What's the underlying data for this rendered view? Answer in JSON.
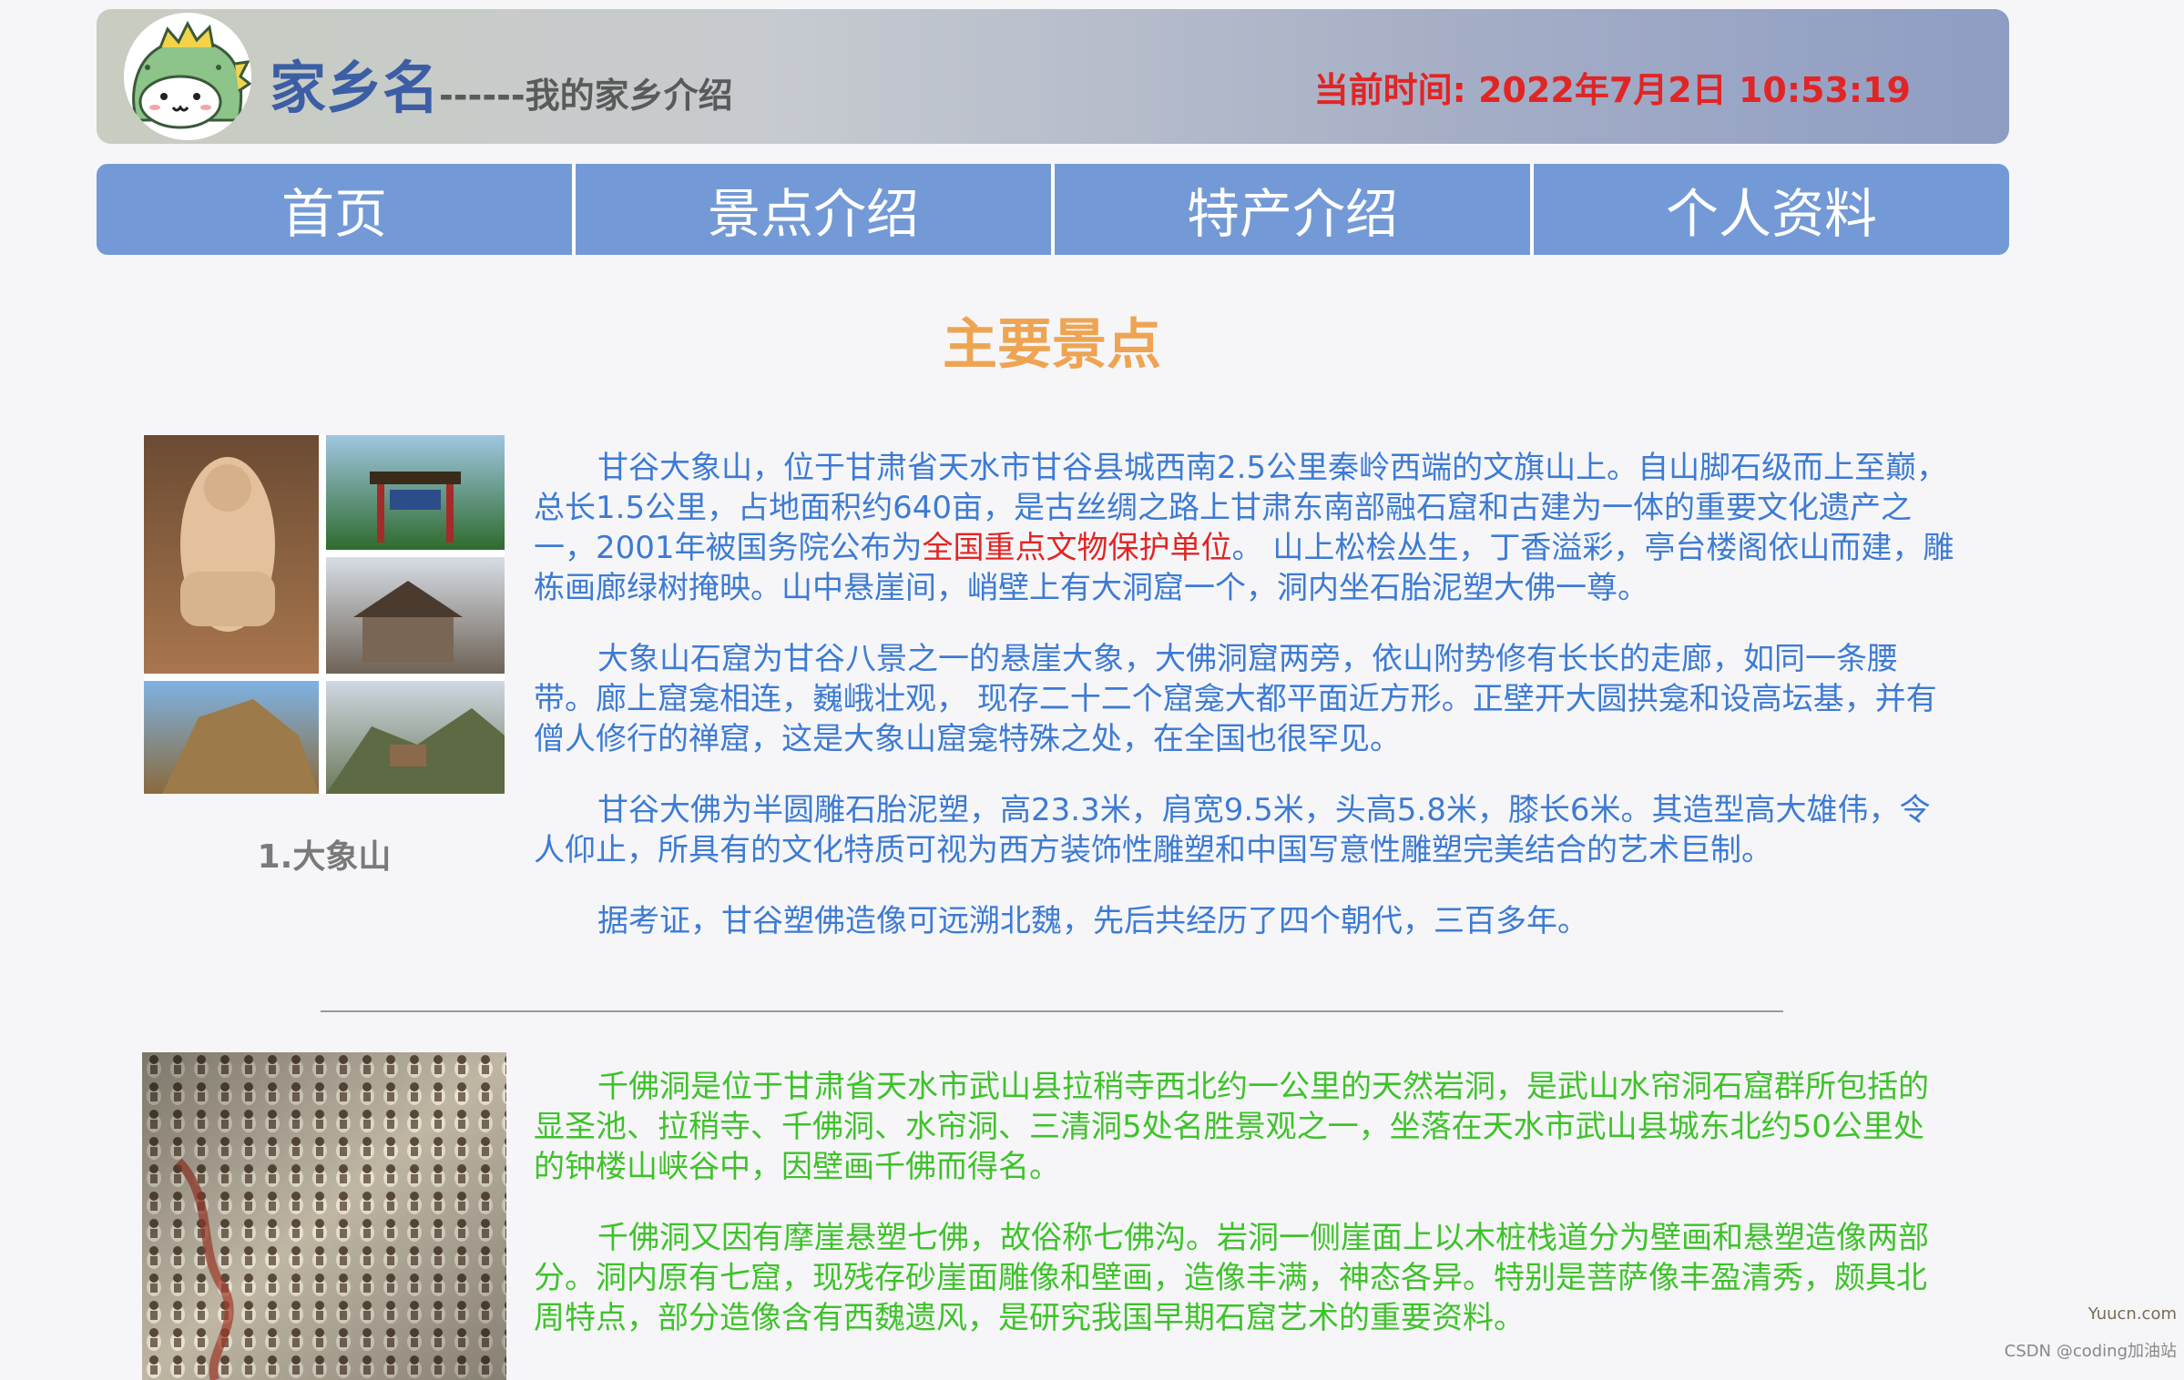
{
  "header": {
    "logo_icon": "dinosaur-mascot-icon",
    "site_name": "家乡名",
    "site_subtitle": "------我的家乡介绍",
    "clock_prefix": "当前时间: ",
    "clock_value": "2022年7月2日 10:53:19"
  },
  "nav": {
    "items": [
      {
        "label": "首页"
      },
      {
        "label": "景点介绍"
      },
      {
        "label": "特产介绍"
      },
      {
        "label": "个人资料"
      }
    ]
  },
  "main": {
    "section_title": "主要景点",
    "spot1": {
      "caption": "1.大象山",
      "p1_before": "甘谷大象山，位于甘肃省天水市甘谷县城西南2.5公里秦岭西端的文旗山上。自山脚石级而上至巅，总长1.5公里，占地面积约640亩，是古丝绸之路上甘肃东南部融石窟和古建为一体的重要文化遗产之一，2001年被国务院公布为",
      "p1_highlight": "全国重点文物保护单位",
      "p1_after": "。 山上松桧丛生，丁香溢彩，亭台楼阁依山而建，雕栋画廊绿树掩映。山中悬崖间，峭壁上有大洞窟一个，洞内坐石胎泥塑大佛一尊。",
      "p2": "大象山石窟为甘谷八景之一的悬崖大象，大佛洞窟两旁，依山附势修有长长的走廊，如同一条腰带。廊上窟龛相连，巍峨壮观， 现存二十二个窟龛大都平面近方形。正壁开大圆拱龛和设高坛基，并有僧人修行的禅窟，这是大象山窟龛特殊之处，在全国也很罕见。",
      "p3": "甘谷大佛为半圆雕石胎泥塑，高23.3米，肩宽9.5米，头高5.8米，膝长6米。其造型高大雄伟，令人仰止，所具有的文化特质可视为西方装饰性雕塑和中国写意性雕塑完美结合的艺术巨制。",
      "p4": "据考证，甘谷塑佛造像可远溯北魏，先后共经历了四个朝代，三百多年。"
    },
    "spot2": {
      "p1": "千佛洞是位于甘肃省天水市武山县拉稍寺西北约一公里的天然岩洞，是武山水帘洞石窟群所包括的显圣池、拉稍寺、千佛洞、水帘洞、三清洞5处名胜景观之一，坐落在天水市武山县城东北约50公里处的钟楼山峡谷中，因壁画千佛而得名。",
      "p2": "千佛洞又因有摩崖悬塑七佛，故俗称七佛沟。岩洞一侧崖面上以木桩栈道分为壁画和悬塑造像两部分。洞内原有七窟，现残存砂崖面雕像和壁画，造像丰满，神态各异。特别是菩萨像丰盈清秀，颇具北周特点，部分造像含有西魏遗风，是研究我国早期石窟艺术的重要资料。"
    }
  },
  "watermark": {
    "site": "Yuucn.com",
    "author": "CSDN @coding加油站"
  },
  "colors": {
    "nav_bg": "#739ad6",
    "clock": "#e12525",
    "section_title": "#eea452",
    "spot1_text": "#3d7bd4",
    "spot2_text": "#3ec22a",
    "highlight": "#e12525"
  }
}
